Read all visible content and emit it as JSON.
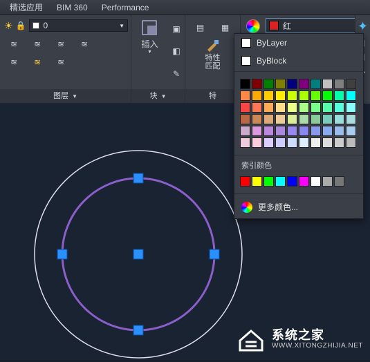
{
  "tabs": {
    "t0": "精选应用",
    "t1": "BIM 360",
    "t2": "Performance"
  },
  "layers": {
    "current": "0",
    "title": "图层"
  },
  "blocks": {
    "insert": "插入",
    "title": "块"
  },
  "props": {
    "match": "特性\n匹配",
    "title": "特"
  },
  "color": {
    "current_label": "红",
    "bylayer": "ByLayer",
    "byblock": "ByBlock",
    "index_label": "索引颜色",
    "more": "更多颜色...",
    "grid": [
      "#000000",
      "#7f0000",
      "#007f00",
      "#7f7f00",
      "#00007f",
      "#7f007f",
      "#007f7f",
      "#c0c0c0",
      "#7f7f7f",
      "#404040",
      "#ff8844",
      "#ffaa00",
      "#ffcc00",
      "#ffee00",
      "#ccff00",
      "#aaff00",
      "#66ff00",
      "#00ff00",
      "#00ffaa",
      "#00ffff",
      "#ff4444",
      "#ff7755",
      "#ffaa55",
      "#ffdd88",
      "#eeff88",
      "#aaff88",
      "#77ff88",
      "#55ffaa",
      "#55ffdd",
      "#88ffff",
      "#bb6644",
      "#cc8855",
      "#ddaa77",
      "#eecc99",
      "#ddee99",
      "#aaddaa",
      "#88cc99",
      "#77ccbb",
      "#99dddd",
      "#aadddd",
      "#ccaacc",
      "#dd99dd",
      "#bb88dd",
      "#aa88dd",
      "#9988ee",
      "#8888ee",
      "#8899ee",
      "#88aaee",
      "#99bbee",
      "#aaccee",
      "#eeccdd",
      "#ffccdd",
      "#ddccff",
      "#ccccff",
      "#ccddff",
      "#ddeeff",
      "#eeeeee",
      "#dddddd",
      "#cccccc",
      "#bbbbbb"
    ],
    "index_colors": [
      "#ff0000",
      "#ffff00",
      "#00ff00",
      "#00ffff",
      "#0000ff",
      "#ff00ff",
      "#ffffff",
      "#aaaaaa",
      "#777777"
    ]
  },
  "watermark": {
    "cn": "系统之家",
    "en": "WWW.XITONGZHIJIA.NET"
  }
}
